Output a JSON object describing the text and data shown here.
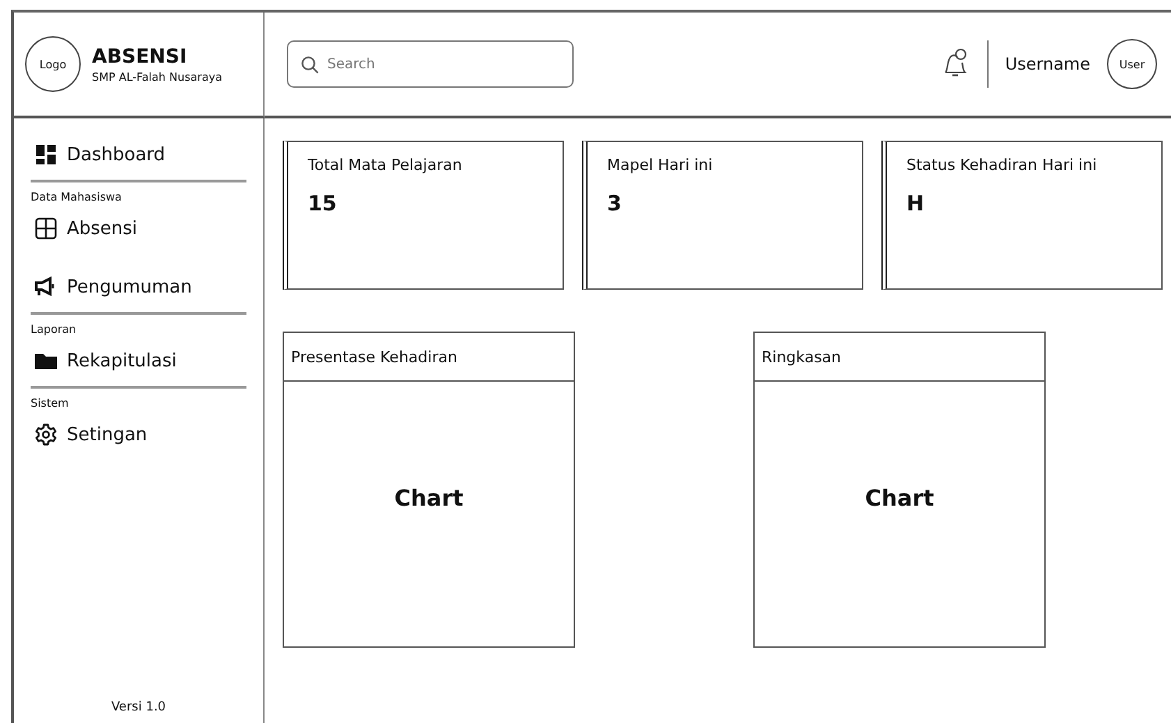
{
  "brand": {
    "logo": "Logo",
    "title": "ABSENSI",
    "subtitle": "SMP  AL-Falah Nusaraya"
  },
  "search": {
    "placeholder": "Search"
  },
  "user": {
    "name": "Username",
    "avatar": "User"
  },
  "sidebar": [
    {
      "kind": "dashboard",
      "label": "Dashboard"
    },
    {
      "kind": "divider"
    },
    {
      "kind": "section",
      "label": "Data Mahasiswa"
    },
    {
      "kind": "table",
      "label": "Absensi"
    },
    {
      "kind": "megaphone",
      "label": "Pengumuman"
    },
    {
      "kind": "divider"
    },
    {
      "kind": "section",
      "label": "Laporan"
    },
    {
      "kind": "folder",
      "label": "Rekapitulasi"
    },
    {
      "kind": "divider"
    },
    {
      "kind": "section",
      "label": "Sistem"
    },
    {
      "kind": "gear",
      "label": "Setingan"
    }
  ],
  "version": "Versi 1.0",
  "stats": [
    {
      "label": "Total Mata Pelajaran",
      "value": "15"
    },
    {
      "label": "Mapel Hari ini",
      "value": "3"
    },
    {
      "label": "Status Kehadiran Hari  ini",
      "value": "H"
    }
  ],
  "panels": [
    {
      "title": "Presentase Kehadiran",
      "body": "Chart"
    },
    {
      "title": "Ringkasan",
      "body": "Chart"
    }
  ]
}
